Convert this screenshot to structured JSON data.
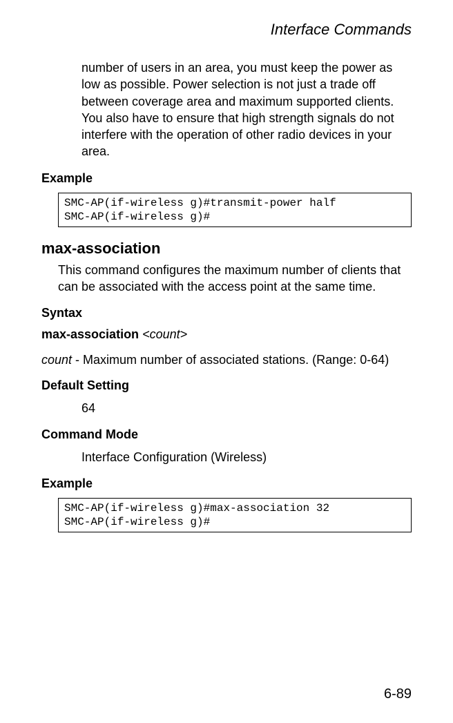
{
  "chapter_title": "Interface Commands",
  "intro_paragraph": "number of users in an area, you must keep the power as low as possible. Power selection is not just a trade off between coverage area and maximum supported clients. You also have to ensure that high strength signals do not interfere with the operation of other radio devices in your area.",
  "labels": {
    "example": "Example",
    "syntax": "Syntax",
    "default_setting": "Default Setting",
    "command_mode": "Command Mode"
  },
  "example1_code": "SMC-AP(if-wireless g)#transmit-power half\nSMC-AP(if-wireless g)#",
  "command2": {
    "name": "max-association",
    "description": "This command configures the maximum number of clients that can be associated with the access point at the same time.",
    "syntax_kw": "max-association",
    "syntax_arg": "<count>",
    "param_name": "count",
    "param_desc": " - Maximum number of associated stations. (Range: 0-64)",
    "default_value": "64",
    "command_mode_value": "Interface Configuration (Wireless)",
    "example_code": "SMC-AP(if-wireless g)#max-association 32\nSMC-AP(if-wireless g)#"
  },
  "page_number": "6-89"
}
